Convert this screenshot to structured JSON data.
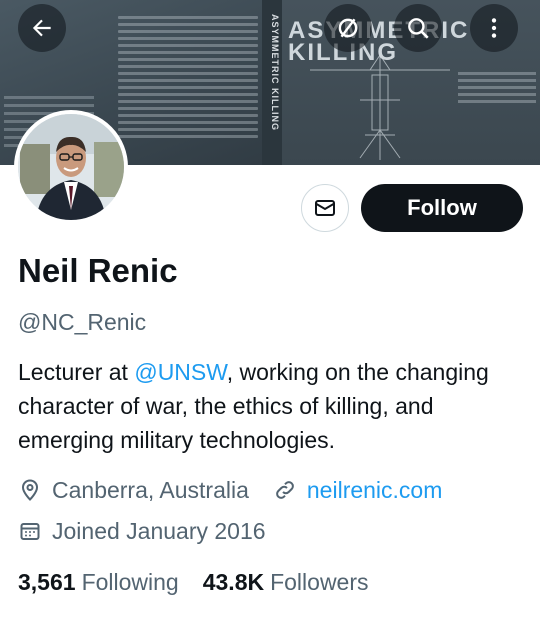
{
  "banner": {
    "spine_text": "ASYMMETRIC KILLING",
    "cover_title_line1": "ASYMMETRIC",
    "cover_title_line2": "KILLING"
  },
  "nav": {
    "back_icon": "arrow-left-icon",
    "mute_icon": "slashed-circle-icon",
    "search_icon": "search-icon",
    "more_icon": "more-vertical-icon"
  },
  "actions": {
    "message_icon": "envelope-icon",
    "follow_label": "Follow"
  },
  "profile": {
    "name": "Neil Renic",
    "handle": "@NC_Renic",
    "bio_prefix": "Lecturer at ",
    "bio_mention": "@UNSW",
    "bio_suffix": ", working on the changing character of war, the ethics of killing, and emerging military technologies.",
    "location": "Canberra, Australia",
    "website": "neilrenic.com",
    "joined": "Joined January 2016"
  },
  "stats": {
    "following_count": "3,561",
    "following_label": "Following",
    "followers_count": "43.8K",
    "followers_label": "Followers"
  },
  "colors": {
    "accent": "#1d9bf0",
    "text_primary": "#0f1419",
    "text_secondary": "#536471",
    "follow_bg": "#0f1419"
  }
}
